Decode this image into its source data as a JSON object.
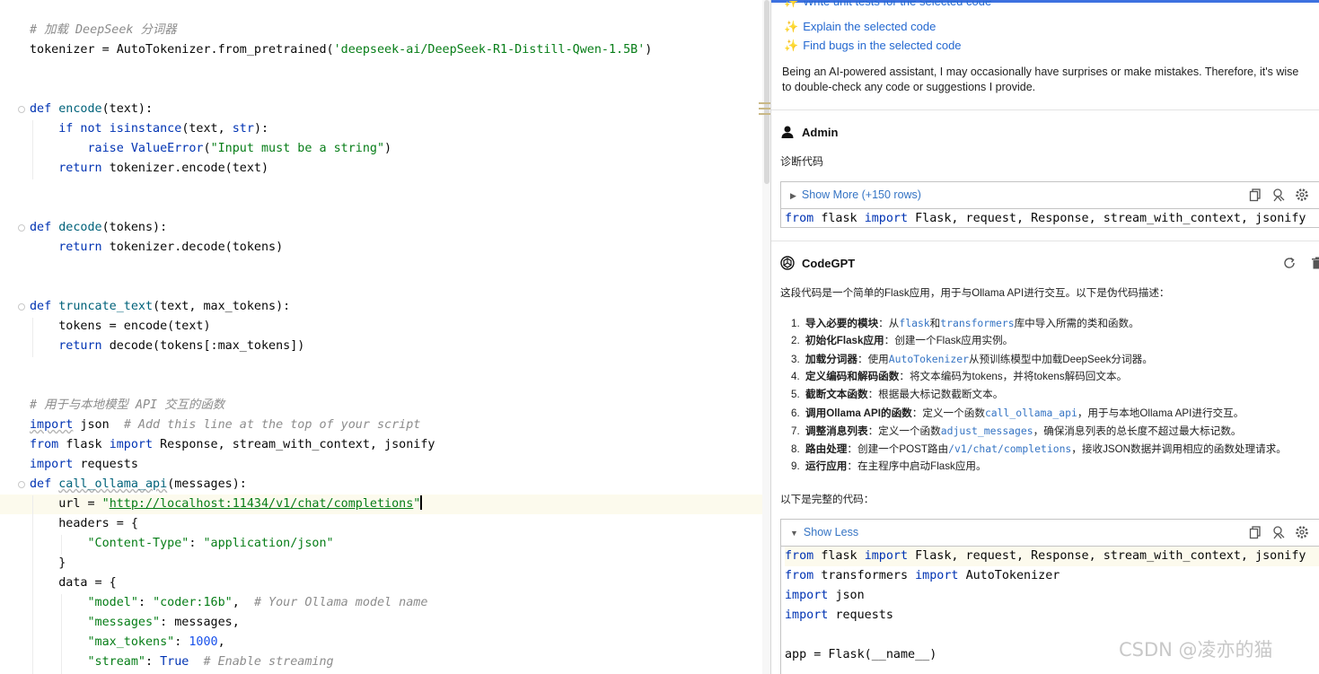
{
  "editor": {
    "lines": [
      {
        "segments": [
          {
            "c": "cm",
            "t": "# 加载 DeepSeek 分词器"
          }
        ]
      },
      {
        "segments": [
          {
            "c": "",
            "t": "tokenizer = AutoTokenizer.from_pretrained("
          },
          {
            "c": "st",
            "t": "'deepseek-ai/DeepSeek-R1-Distill-Qwen-1.5B'"
          },
          {
            "c": "",
            "t": ")"
          }
        ]
      },
      {
        "segments": []
      },
      {
        "segments": []
      },
      {
        "segments": [
          {
            "c": "kw",
            "t": "def "
          },
          {
            "c": "fn",
            "t": "encode"
          },
          {
            "c": "",
            "t": "(text):"
          }
        ]
      },
      {
        "segments": [
          {
            "c": "kw",
            "t": "    if not "
          },
          {
            "c": "kw",
            "t": "isinstance"
          },
          {
            "c": "",
            "t": "(text, "
          },
          {
            "c": "kw",
            "t": "str"
          },
          {
            "c": "",
            "t": "):"
          }
        ]
      },
      {
        "segments": [
          {
            "c": "kw",
            "t": "        raise "
          },
          {
            "c": "kw",
            "t": "ValueError"
          },
          {
            "c": "",
            "t": "("
          },
          {
            "c": "st",
            "t": "\"Input must be a string\""
          },
          {
            "c": "",
            "t": ")"
          }
        ]
      },
      {
        "segments": [
          {
            "c": "kw",
            "t": "    return "
          },
          {
            "c": "",
            "t": "tokenizer.encode(text)"
          }
        ]
      },
      {
        "segments": []
      },
      {
        "segments": []
      },
      {
        "segments": [
          {
            "c": "kw",
            "t": "def "
          },
          {
            "c": "fn",
            "t": "decode"
          },
          {
            "c": "",
            "t": "(tokens):"
          }
        ]
      },
      {
        "segments": [
          {
            "c": "kw",
            "t": "    return "
          },
          {
            "c": "",
            "t": "tokenizer.decode(tokens)"
          }
        ]
      },
      {
        "segments": []
      },
      {
        "segments": []
      },
      {
        "segments": [
          {
            "c": "kw",
            "t": "def "
          },
          {
            "c": "fn",
            "t": "truncate_text"
          },
          {
            "c": "",
            "t": "(text, max_tokens):"
          }
        ]
      },
      {
        "segments": [
          {
            "c": "",
            "t": "    tokens = encode(text)"
          }
        ]
      },
      {
        "segments": [
          {
            "c": "kw",
            "t": "    return "
          },
          {
            "c": "",
            "t": "decode(tokens[:max_tokens])"
          }
        ]
      },
      {
        "segments": []
      },
      {
        "segments": []
      },
      {
        "segments": [
          {
            "c": "cm",
            "t": "# 用于与本地模型 API 交互的函数"
          }
        ]
      },
      {
        "segments": [
          {
            "c": "kw ul",
            "t": "import"
          },
          {
            "c": "",
            "t": " json  "
          },
          {
            "c": "cm",
            "t": "# Add this line at the top of your script"
          }
        ]
      },
      {
        "segments": [
          {
            "c": "kw",
            "t": "from "
          },
          {
            "c": "",
            "t": "flask "
          },
          {
            "c": "kw",
            "t": "import "
          },
          {
            "c": "",
            "t": "Response, stream_with_context, jsonify"
          }
        ]
      },
      {
        "segments": [
          {
            "c": "kw",
            "t": "import "
          },
          {
            "c": "",
            "t": "requests"
          }
        ]
      },
      {
        "segments": [
          {
            "c": "kw",
            "t": "def "
          },
          {
            "c": "fn ul",
            "t": "call_ollama_api"
          },
          {
            "c": "",
            "t": "(messages):"
          }
        ]
      },
      {
        "segments": [
          {
            "c": "",
            "t": "    url = "
          },
          {
            "c": "st",
            "t": "\""
          },
          {
            "c": "url",
            "t": "http://localhost:11434/v1/chat/completions"
          },
          {
            "c": "st",
            "t": "\""
          },
          {
            "c": "caret",
            "t": ""
          }
        ]
      },
      {
        "segments": [
          {
            "c": "",
            "t": "    headers = {"
          }
        ]
      },
      {
        "segments": [
          {
            "c": "st",
            "t": "        \"Content-Type\""
          },
          {
            "c": "",
            "t": ": "
          },
          {
            "c": "st",
            "t": "\"application/json\""
          }
        ]
      },
      {
        "segments": [
          {
            "c": "",
            "t": "    }"
          }
        ]
      },
      {
        "segments": [
          {
            "c": "",
            "t": "    data = {"
          }
        ]
      },
      {
        "segments": [
          {
            "c": "st",
            "t": "        \"model\""
          },
          {
            "c": "",
            "t": ": "
          },
          {
            "c": "st",
            "t": "\"coder:16b\""
          },
          {
            "c": "",
            "t": ",  "
          },
          {
            "c": "cm",
            "t": "# Your Ollama model name"
          }
        ]
      },
      {
        "segments": [
          {
            "c": "st",
            "t": "        \"messages\""
          },
          {
            "c": "",
            "t": ": messages,"
          }
        ]
      },
      {
        "segments": [
          {
            "c": "st",
            "t": "        \"max_tokens\""
          },
          {
            "c": "",
            "t": ": "
          },
          {
            "c": "nu",
            "t": "1000"
          },
          {
            "c": "",
            "t": ","
          }
        ]
      },
      {
        "segments": [
          {
            "c": "st",
            "t": "        \"stream\""
          },
          {
            "c": "",
            "t": ": "
          },
          {
            "c": "kw",
            "t": "True"
          },
          {
            "c": "",
            "t": "  "
          },
          {
            "c": "cm",
            "t": "# Enable streaming"
          }
        ]
      }
    ],
    "current_line_index": 24
  },
  "chat": {
    "suggestions": [
      "Write unit tests for the selected code",
      "Explain the selected code",
      "Find bugs in the selected code"
    ],
    "disclaimer": "Being an AI-powered assistant, I may occasionally have surprises or make mistakes. Therefore, it's wise to double-check any code or suggestions I provide.",
    "user": {
      "name": "Admin",
      "message": "诊断代码",
      "code_toggle": "Show More (+150 rows)",
      "code_preview": [
        [
          {
            "c": "kw",
            "t": "from "
          },
          {
            "c": "",
            "t": "flask "
          },
          {
            "c": "kw",
            "t": "import "
          },
          {
            "c": "",
            "t": "Flask, request, Response, stream_with_context, jsonify"
          }
        ]
      ]
    },
    "assistant": {
      "name": "CodeGPT",
      "intro": "这段代码是一个简单的Flask应用，用于与Ollama API进行交互。以下是伪代码描述：",
      "steps": [
        {
          "num": "1.",
          "title": "导入必要的模块",
          "parts": [
            {
              "m": false,
              "t": "：从"
            },
            {
              "m": true,
              "t": "flask"
            },
            {
              "m": false,
              "t": "和"
            },
            {
              "m": true,
              "t": "transformers"
            },
            {
              "m": false,
              "t": "库中导入所需的类和函数。"
            }
          ]
        },
        {
          "num": "2.",
          "title": "初始化Flask应用",
          "parts": [
            {
              "m": false,
              "t": "：创建一个Flask应用实例。"
            }
          ]
        },
        {
          "num": "3.",
          "title": "加载分词器",
          "parts": [
            {
              "m": false,
              "t": "：使用"
            },
            {
              "m": true,
              "t": "AutoTokenizer"
            },
            {
              "m": false,
              "t": "从预训练模型中加载DeepSeek分词器。"
            }
          ]
        },
        {
          "num": "4.",
          "title": "定义编码和解码函数",
          "parts": [
            {
              "m": false,
              "t": "：将文本编码为tokens，并将tokens解码回文本。"
            }
          ]
        },
        {
          "num": "5.",
          "title": "截断文本函数",
          "parts": [
            {
              "m": false,
              "t": "：根据最大标记数截断文本。"
            }
          ]
        },
        {
          "num": "6.",
          "title": "调用Ollama API的函数",
          "parts": [
            {
              "m": false,
              "t": "：定义一个函数"
            },
            {
              "m": true,
              "t": "call_ollama_api"
            },
            {
              "m": false,
              "t": "，用于与本地Ollama API进行交互。"
            }
          ]
        },
        {
          "num": "7.",
          "title": "调整消息列表",
          "parts": [
            {
              "m": false,
              "t": "：定义一个函数"
            },
            {
              "m": true,
              "t": "adjust_messages"
            },
            {
              "m": false,
              "t": "，确保消息列表的总长度不超过最大标记数。"
            }
          ]
        },
        {
          "num": "8.",
          "title": "路由处理",
          "parts": [
            {
              "m": false,
              "t": "：创建一个POST路由"
            },
            {
              "m": true,
              "t": "/v1/chat/completions"
            },
            {
              "m": false,
              "t": "，接收JSON数据并调用相应的函数处理请求。"
            }
          ]
        },
        {
          "num": "9.",
          "title": "运行应用",
          "parts": [
            {
              "m": false,
              "t": "：在主程序中启动Flask应用。"
            }
          ]
        }
      ],
      "outro": "以下是完整的代码：",
      "code_toggle": "Show Less",
      "code_lines": [
        [
          {
            "c": "kw",
            "t": "from "
          },
          {
            "c": "",
            "t": "flask "
          },
          {
            "c": "kw",
            "t": "import "
          },
          {
            "c": "",
            "t": "Flask, request, Response, stream_with_context, jsonify"
          }
        ],
        [
          {
            "c": "kw",
            "t": "from "
          },
          {
            "c": "",
            "t": "transformers "
          },
          {
            "c": "kw",
            "t": "import "
          },
          {
            "c": "",
            "t": "AutoTokenizer"
          }
        ],
        [
          {
            "c": "kw",
            "t": "import "
          },
          {
            "c": "",
            "t": "json"
          }
        ],
        [
          {
            "c": "kw",
            "t": "import "
          },
          {
            "c": "",
            "t": "requests"
          }
        ],
        [],
        [
          {
            "c": "",
            "t": "app = Flask(__name__)"
          }
        ]
      ]
    }
  },
  "watermark": "CSDN @凌亦的猫",
  "colors": {
    "accent": "#3d71e0",
    "link": "#2468d0",
    "keyword": "#0033b3",
    "string": "#067d17",
    "comment": "#8c8c8c"
  }
}
